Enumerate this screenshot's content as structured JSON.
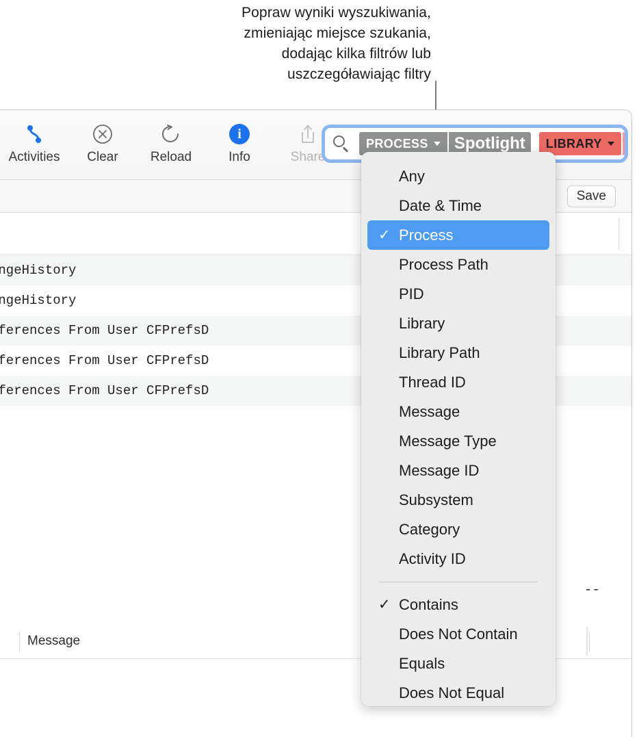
{
  "callout": {
    "lines": [
      "Popraw wyniki wyszukiwania,",
      "zmieniając miejsce szukania,",
      "dodając kilka filtrów lub",
      "uszczegóławiając filtry"
    ]
  },
  "toolbar": {
    "buttons": [
      {
        "label": "Activities",
        "icon": "activities-icon",
        "disabled": false
      },
      {
        "label": "Clear",
        "icon": "clear-circle-x-icon",
        "disabled": false
      },
      {
        "label": "Reload",
        "icon": "reload-arrow-icon",
        "disabled": false
      },
      {
        "label": "Info",
        "icon": "info-badge-icon",
        "disabled": false
      },
      {
        "label": "Share",
        "icon": "share-arrow-up-icon",
        "disabled": true
      }
    ]
  },
  "search": {
    "magnifier_icon": "search-icon",
    "tokens": [
      {
        "label": "PROCESS",
        "type": "field",
        "color": "#8e918f",
        "has_chevron": true
      },
      {
        "label": "Spotlight",
        "type": "value",
        "color": "#8e918f",
        "has_chevron": false
      },
      {
        "label": "LIBRARY",
        "type": "field",
        "color": "#ec6a64",
        "has_chevron": true
      }
    ]
  },
  "save_bar": {
    "save_label": "Save"
  },
  "table": {
    "column_header": "Message",
    "empty_value": "--",
    "rows": [
      {
        "text": "angeHistory",
        "alt": true
      },
      {
        "text": "angeHistory",
        "alt": false
      },
      {
        "text": "eferences From User CFPrefsD",
        "alt": true
      },
      {
        "text": "eferences From User CFPrefsD",
        "alt": false
      },
      {
        "text": "eferences From User CFPrefsD",
        "alt": true
      }
    ]
  },
  "menu": {
    "accent_color": "#4d9bf3",
    "groups": [
      {
        "items": [
          {
            "label": "Any",
            "checked": false
          },
          {
            "label": "Date & Time",
            "checked": false
          },
          {
            "label": "Process",
            "checked": true,
            "selected": true
          },
          {
            "label": "Process Path",
            "checked": false
          },
          {
            "label": "PID",
            "checked": false
          },
          {
            "label": "Library",
            "checked": false
          },
          {
            "label": "Library Path",
            "checked": false
          },
          {
            "label": "Thread ID",
            "checked": false
          },
          {
            "label": "Message",
            "checked": false
          },
          {
            "label": "Message Type",
            "checked": false
          },
          {
            "label": "Message ID",
            "checked": false
          },
          {
            "label": "Subsystem",
            "checked": false
          },
          {
            "label": "Category",
            "checked": false
          },
          {
            "label": "Activity ID",
            "checked": false
          }
        ]
      },
      {
        "items": [
          {
            "label": "Contains",
            "checked": true
          },
          {
            "label": "Does Not Contain",
            "checked": false
          },
          {
            "label": "Equals",
            "checked": false
          },
          {
            "label": "Does Not Equal",
            "checked": false
          }
        ]
      }
    ],
    "checkmark": "✓"
  }
}
